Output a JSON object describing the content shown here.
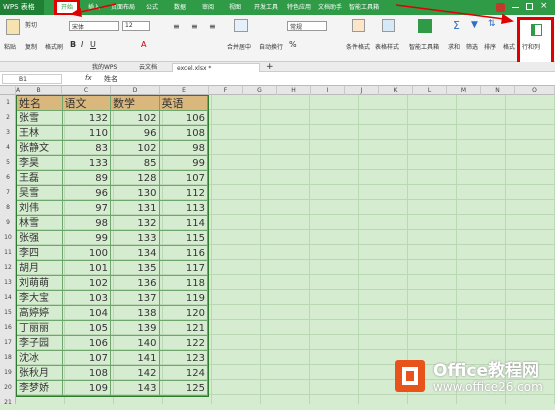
{
  "app": {
    "name": "WPS 表格"
  },
  "menu": [
    "开始",
    "插入",
    "页面布局",
    "公式",
    "数据",
    "审阅",
    "视图",
    "开发工具",
    "特色应用",
    "文档助手",
    "智能工具箱"
  ],
  "ribbon": {
    "paste": "粘贴",
    "cut": "剪切",
    "copy": "复制",
    "format_painter": "格式刷",
    "font_name": "宋体",
    "font_size": "12",
    "merge_center": "合并居中",
    "wrap": "自动换行",
    "number_format": "常规",
    "cond_format": "条件格式",
    "table_style": "表格样式",
    "smart_toolbox": "智能工具箱",
    "sum": "求和",
    "filter": "筛选",
    "sort": "排序",
    "format": "格式",
    "row_col": "行和列"
  },
  "file_tabs": [
    "我的WPS",
    "云文档",
    "excel.xlsx *"
  ],
  "formula_bar": {
    "cell_ref": "B1",
    "fx": "fx",
    "value": "姓名"
  },
  "columns": [
    "A",
    "B",
    "C",
    "D",
    "E",
    "F",
    "G",
    "H",
    "I",
    "J",
    "K",
    "L",
    "M",
    "N",
    "O"
  ],
  "rows": [
    "1",
    "2",
    "3",
    "4",
    "5",
    "6",
    "7",
    "8",
    "9",
    "10",
    "11",
    "12",
    "13",
    "14",
    "15",
    "16",
    "17",
    "18",
    "19",
    "20",
    "21"
  ],
  "table": {
    "headers": [
      "姓名",
      "语文",
      "数学",
      "英语"
    ],
    "rows": [
      [
        "张雪",
        "132",
        "102",
        "106"
      ],
      [
        "王林",
        "110",
        "96",
        "108"
      ],
      [
        "张静文",
        "83",
        "102",
        "98"
      ],
      [
        "李昊",
        "133",
        "85",
        "99"
      ],
      [
        "王磊",
        "89",
        "128",
        "107"
      ],
      [
        "吴雪",
        "96",
        "130",
        "112"
      ],
      [
        "刘伟",
        "97",
        "131",
        "113"
      ],
      [
        "林雪",
        "98",
        "132",
        "114"
      ],
      [
        "张强",
        "99",
        "133",
        "115"
      ],
      [
        "李四",
        "100",
        "134",
        "116"
      ],
      [
        "胡月",
        "101",
        "135",
        "117"
      ],
      [
        "刘萌萌",
        "102",
        "136",
        "118"
      ],
      [
        "李大宝",
        "103",
        "137",
        "119"
      ],
      [
        "高婷婷",
        "104",
        "138",
        "120"
      ],
      [
        "丁丽丽",
        "105",
        "139",
        "121"
      ],
      [
        "李子园",
        "106",
        "140",
        "122"
      ],
      [
        "沈冰",
        "107",
        "141",
        "123"
      ],
      [
        "张秋月",
        "108",
        "142",
        "124"
      ],
      [
        "李梦娇",
        "109",
        "143",
        "125"
      ]
    ]
  },
  "watermark": {
    "brand": "Office教程网",
    "url": "www.office26.com"
  }
}
